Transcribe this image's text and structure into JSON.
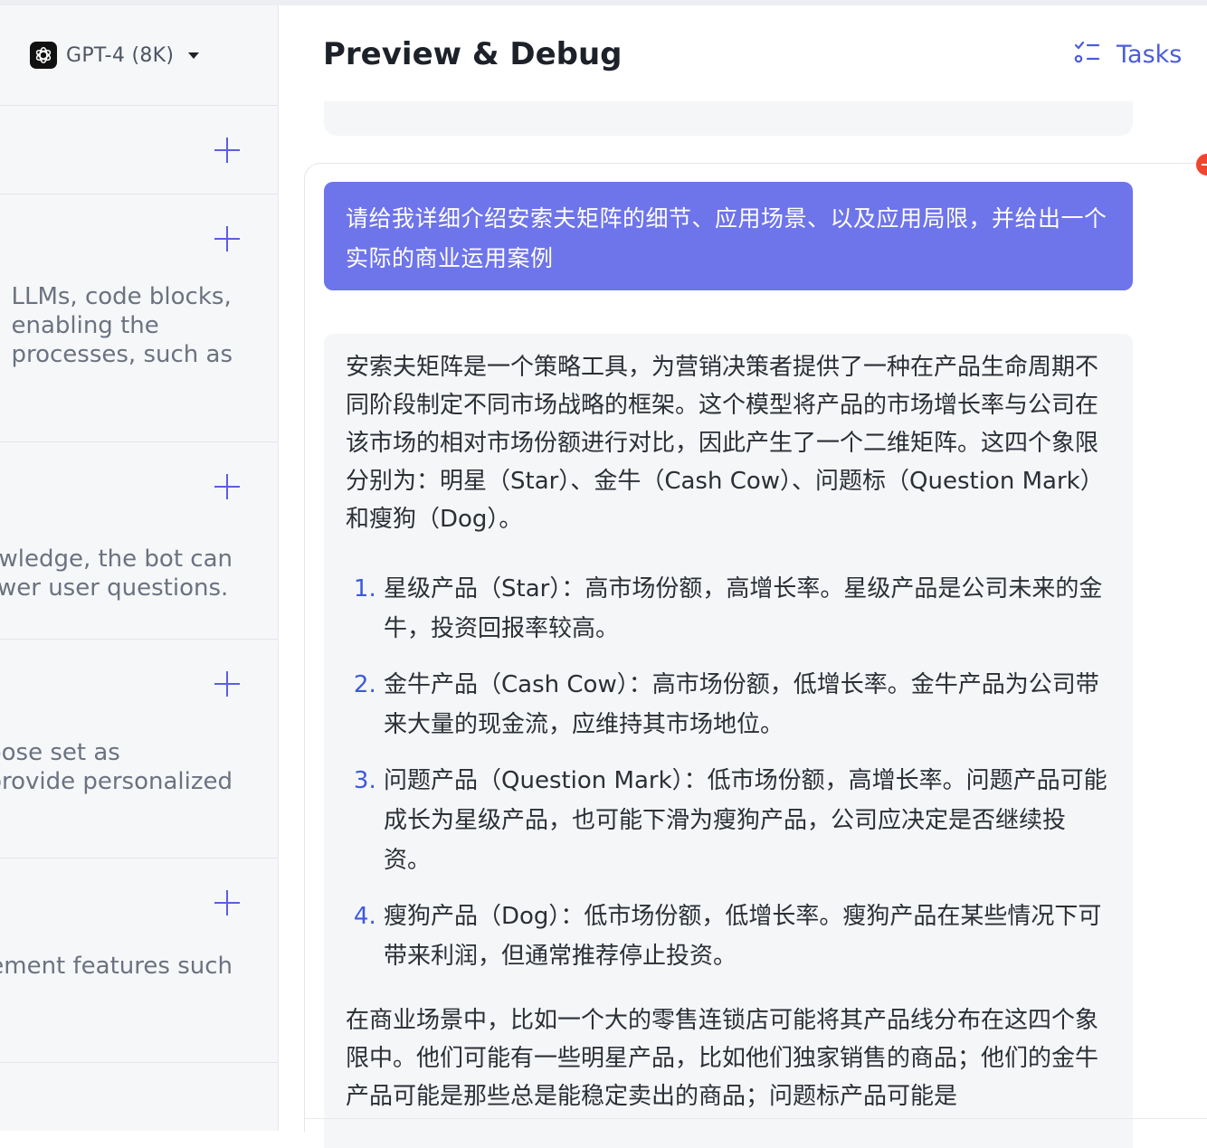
{
  "left_panel": {
    "model_label": "GPT-4 (8K)",
    "sections": [
      {
        "lines": []
      },
      {
        "lines": [
          "LLMs, code blocks,",
          "enabling the",
          "processes, such as"
        ]
      },
      {
        "lines": [
          "knowledge, the bot can",
          "answer user questions."
        ]
      },
      {
        "lines": [
          "Choose set as",
          "to provide personalized"
        ]
      },
      {
        "lines": [
          "management features such"
        ]
      }
    ]
  },
  "header": {
    "title": "Preview & Debug",
    "tasks_label": "Tasks"
  },
  "chat": {
    "user_message": "请给我详细介绍安索夫矩阵的细节、应用场景、以及应用局限，并给出一个实际的商业运用案例",
    "bot_intro": "安索夫矩阵是一个策略工具，为营销决策者提供了一种在产品生命周期不同阶段制定不同市场战略的框架。这个模型将产品的市场增长率与公司在该市场的相对市场份额进行对比，因此产生了一个二维矩阵。这四个象限分别为：明星（Star）、金牛（Cash Cow）、问题标（Question Mark）和瘦狗（Dog）。",
    "bot_list": [
      "星级产品（Star）：高市场份额，高增长率。星级产品是公司未来的金牛，投资回报率较高。",
      "金牛产品（Cash Cow）：高市场份额，低增长率。金牛产品为公司带来大量的现金流，应维持其市场地位。",
      "问题产品（Question Mark）：低市场份额，高增长率。问题产品可能成长为星级产品，也可能下滑为瘦狗产品，公司应决定是否继续投资。",
      "瘦狗产品（Dog）：低市场份额，低增长率。瘦狗产品在某些情况下可带来利润，但通常推荐停止投资。"
    ],
    "bot_outro": "在商业场景中，比如一个大的零售连锁店可能将其产品线分布在这四个象限中。他们可能有一些明星产品，比如他们独家销售的商品；他们的金牛产品可能是那些总是能稳定卖出的商品；问题标产品可能是"
  },
  "colors": {
    "accent": "#5b5ee0",
    "user_bubble": "#6e74ea",
    "tasks": "#4b5cdb",
    "list_marker": "#3b5bdb",
    "alert_dot": "#f0452e"
  },
  "icons": [
    "openai-logo-icon",
    "caret-down-icon",
    "plus-icon",
    "tasks-icon",
    "remove-icon"
  ]
}
